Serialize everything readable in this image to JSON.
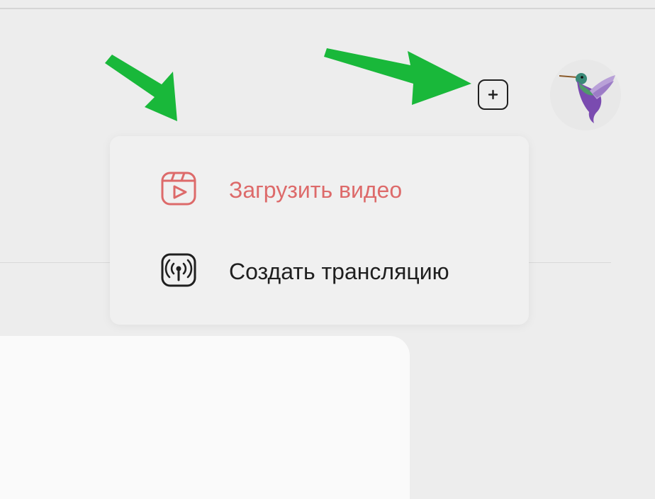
{
  "header": {
    "add_button_icon": "plus-square-icon",
    "avatar_icon": "hummingbird-avatar"
  },
  "create_menu": {
    "items": [
      {
        "label": "Загрузить видео",
        "icon": "video-upload-icon",
        "color": "#dd6a6a"
      },
      {
        "label": "Создать трансляцию",
        "icon": "broadcast-icon",
        "color": "#1f1f1f"
      }
    ]
  },
  "annotations": {
    "arrow_color": "#19b83a"
  }
}
